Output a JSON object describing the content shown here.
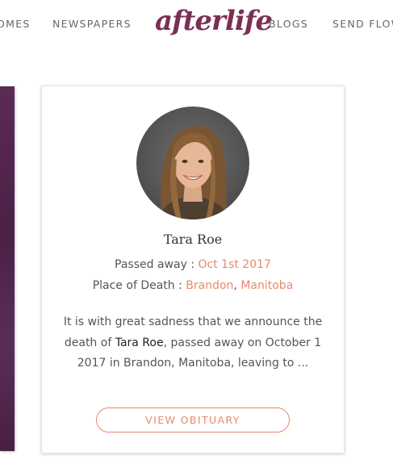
{
  "nav": {
    "items": [
      {
        "label": "OMES"
      },
      {
        "label": "NEWSPAPERS"
      },
      {
        "label": "BLOGS"
      },
      {
        "label": "SEND FLOW"
      }
    ],
    "logo_text": "afterlife"
  },
  "card": {
    "name": "Tara Roe",
    "passed_away_label": "Passed away : ",
    "passed_away_date": "Oct 1st 2017",
    "place_label": "Place of Death : ",
    "city": "Brandon",
    "separator": ", ",
    "province": "Manitoba",
    "excerpt_before": "It is with great sadness that we announce the death of ",
    "excerpt_name": "Tara Roe",
    "excerpt_after": ", passed away on October 1 2017 in Brandon, Manitoba, leaving to ...",
    "button_label": "VIEW OBITUARY"
  },
  "colors": {
    "brand": "#7a2f55",
    "accent": "#e8896b",
    "neighbor_card": "#4b2047"
  }
}
